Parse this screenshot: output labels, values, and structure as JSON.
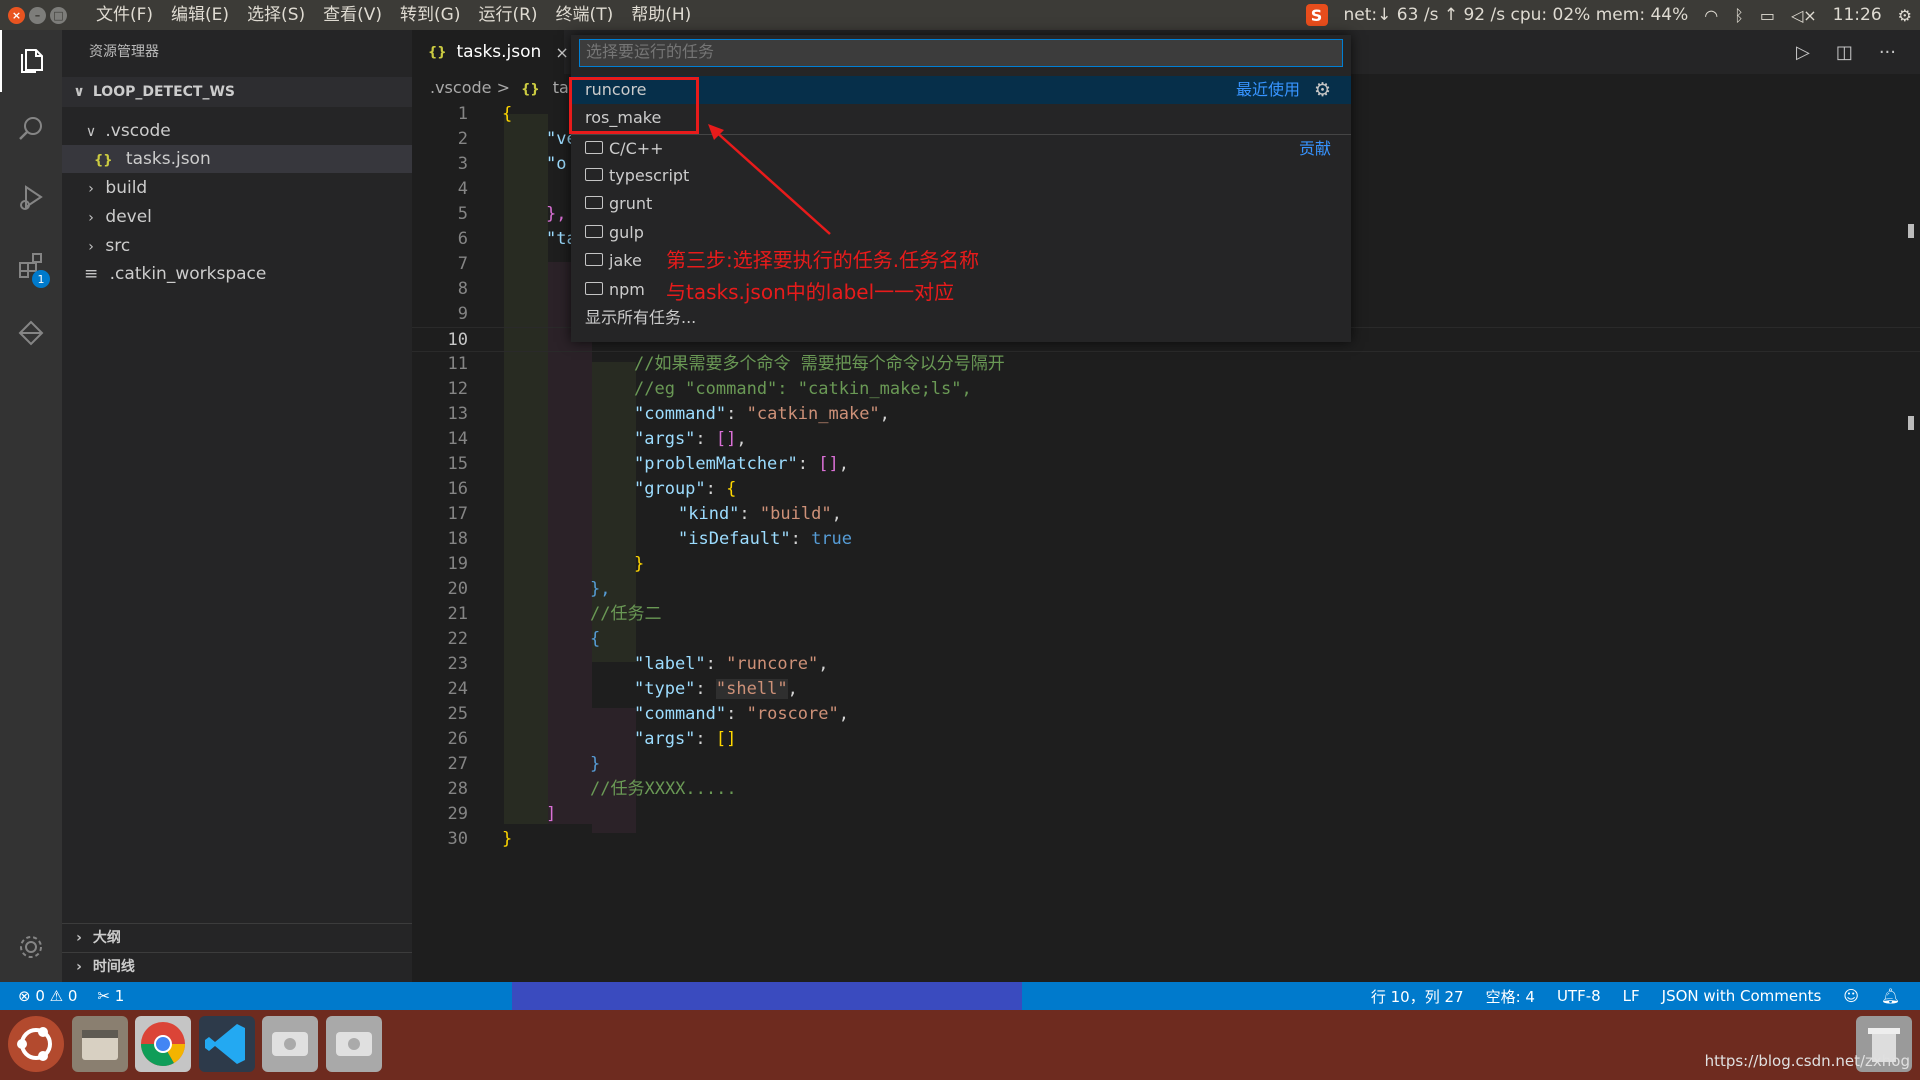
{
  "topbar": {
    "menu": [
      "文件(F)",
      "编辑(E)",
      "选择(S)",
      "查看(V)",
      "转到(G)",
      "运行(R)",
      "终端(T)",
      "帮助(H)"
    ],
    "status": "net:↓ 63 /s ↑ 92 /s cpu: 02% mem: 44%",
    "clock": "11:26"
  },
  "sidebar": {
    "title": "资源管理器",
    "workspace": "LOOP_DETECT_WS",
    "items": [
      {
        "label": ".vscode",
        "chev": "∨"
      },
      {
        "label": "tasks.json",
        "icon": "{}"
      },
      {
        "label": "build",
        "chev": "›"
      },
      {
        "label": "devel",
        "chev": "›"
      },
      {
        "label": "src",
        "chev": "›"
      },
      {
        "label": ".catkin_workspace",
        "icon": "≡"
      }
    ],
    "outline": "大纲",
    "timeline": "时间线",
    "badge": "1"
  },
  "tab": {
    "icon": "{}",
    "label": "tasks.json",
    "close": "×"
  },
  "breadcrumb": {
    "folder": ".vscode",
    "sep": ">",
    "icon": "{}",
    "file": "task"
  },
  "editor": {
    "line_numbers": [
      "1",
      "2",
      "3",
      "4",
      "5",
      "6",
      "7",
      "8",
      "9",
      "10",
      "11",
      "12",
      "13",
      "14",
      "15",
      "16",
      "17",
      "18",
      "19",
      "20",
      "21",
      "22",
      "23",
      "24",
      "25",
      "26",
      "27",
      "28",
      "29",
      "30"
    ],
    "frag_2": "\"ve",
    "frag_3": "\"o",
    "frag_5": "},",
    "frag_6": "\"ta",
    "line_1": "{",
    "line_11": "//如果需要多个命令 需要把每个命令以分号隔开",
    "line_12": "//eg \"command\": \"catkin_make;ls\",",
    "line_13_k": "\"command\"",
    "line_13_v": "\"catkin_make\"",
    "line_14_k": "\"args\"",
    "line_15_k": "\"problemMatcher\"",
    "line_16_k": "\"group\"",
    "line_17_k": "\"kind\"",
    "line_17_v": "\"build\"",
    "line_18_k": "\"isDefault\"",
    "line_18_v": "true",
    "line_21": "//任务二",
    "line_23_k": "\"label\"",
    "line_23_v": "\"runcore\"",
    "line_24_k": "\"type\"",
    "line_24_v": "\"shell\"",
    "line_25_k": "\"command\"",
    "line_25_v": "\"roscore\"",
    "line_26_k": "\"args\"",
    "line_28": "//任务XXXX.....",
    "line_29": "]",
    "line_30": "}"
  },
  "quickpick": {
    "placeholder": "选择要运行的任务",
    "recent_label": "最近使用",
    "contribute_label": "贡献",
    "items": [
      "runcore",
      "ros_make"
    ],
    "groups": [
      "C/C++",
      "typescript",
      "grunt",
      "gulp",
      "jake",
      "npm"
    ],
    "show_all": "显示所有任务..."
  },
  "annotation": {
    "line1": "第三步:选择要执行的任务.任务名称",
    "line2": "与tasks.json中的label一一对应"
  },
  "statusbar": {
    "errors": "⊗ 0 ⚠ 0",
    "ports": "✂ 1",
    "position": "行 10，列 27",
    "spaces": "空格: 4",
    "encoding": "UTF-8",
    "eol": "LF",
    "language": "JSON with Comments"
  },
  "taskbar": {
    "watermark": "https://blog.csdn.net/zxhog"
  }
}
